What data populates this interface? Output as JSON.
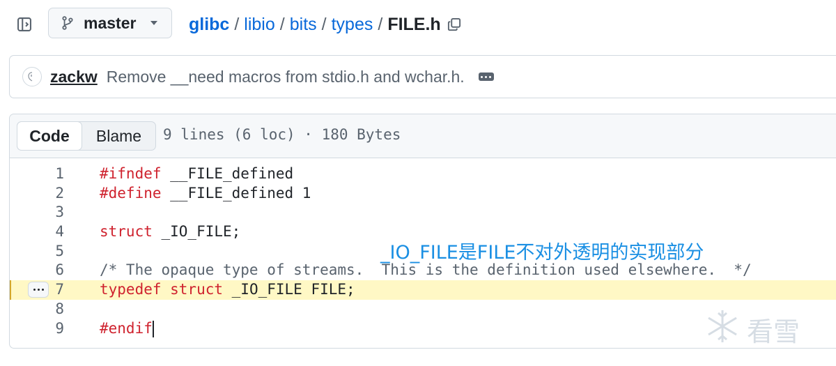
{
  "branch": {
    "name": "master"
  },
  "breadcrumb": {
    "root": "glibc",
    "parts": [
      "libio",
      "bits",
      "types"
    ],
    "file": "FILE.h",
    "separator": "/"
  },
  "commit": {
    "author": "zackw",
    "message": "Remove __need macros from stdio.h and wchar.h."
  },
  "file_header": {
    "code_tab": "Code",
    "blame_tab": "Blame",
    "info": "9 lines (6 loc) · 180 Bytes"
  },
  "code_lines": [
    {
      "num": "1",
      "kw": "#ifndef",
      "rest": " __FILE_defined"
    },
    {
      "num": "2",
      "kw": "#define",
      "rest": " __FILE_defined 1"
    },
    {
      "num": "3",
      "kw": "",
      "rest": ""
    },
    {
      "num": "4",
      "kw": "struct",
      "rest": " _IO_FILE;"
    },
    {
      "num": "5",
      "kw": "",
      "rest": ""
    },
    {
      "num": "6",
      "comment": "/* The opaque type of streams.  This is the definition used elsewhere.  */"
    },
    {
      "num": "7",
      "kw": "typedef struct",
      "rest": " _IO_FILE FILE;",
      "highlight": true
    },
    {
      "num": "8",
      "kw": "",
      "rest": ""
    },
    {
      "num": "9",
      "kw": "#endif",
      "rest": ""
    }
  ],
  "annotation": "_IO_FILE是FILE不对外透明的实现部分",
  "watermark": "看雪",
  "colors": {
    "link": "#0969da",
    "keyword": "#cf222e",
    "comment": "#59636e",
    "highlight": "#fff8c5",
    "annotation": "#1a8fe3"
  },
  "icons": {
    "sidebar": "sidebar-collapse-icon",
    "branch": "git-branch-icon",
    "copy": "copy-icon",
    "commit_expand": "ellipsis-icon"
  }
}
